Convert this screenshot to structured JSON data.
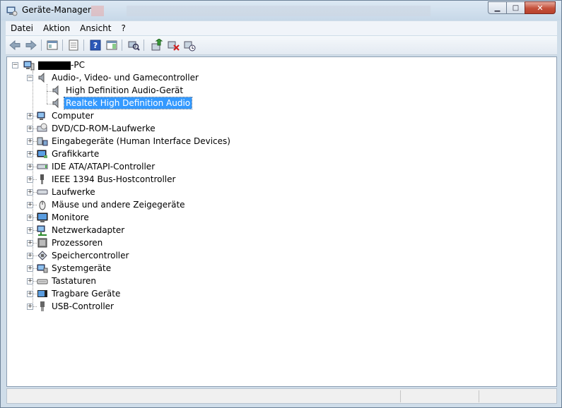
{
  "window": {
    "title": "Geräte-Manager",
    "controls": {
      "minimize": "▁",
      "maximize": "□",
      "close": "✕"
    }
  },
  "menu": [
    "Datei",
    "Aktion",
    "Ansicht",
    "?"
  ],
  "toolbar": {
    "buttons": [
      "back-arrow-icon",
      "forward-arrow-icon",
      "show-hide-console-tree-icon",
      "properties-icon",
      "help-icon",
      "action-pane-icon",
      "scan-hardware-icon",
      "update-driver-icon",
      "disable-device-icon",
      "uninstall-device-icon"
    ]
  },
  "tree": {
    "root_suffix": "-PC",
    "audio_category": "Audio-, Video- und Gamecontroller",
    "audio_children": [
      "High Definition Audio-Gerät",
      "Realtek High Definition Audio"
    ],
    "selected_item": "Realtek High Definition Audio",
    "categories": [
      "Computer",
      "DVD/CD-ROM-Laufwerke",
      "Eingabegeräte (Human Interface Devices)",
      "Grafikkarte",
      "IDE ATA/ATAPI-Controller",
      "IEEE 1394 Bus-Hostcontroller",
      "Laufwerke",
      "Mäuse und andere Zeigegeräte",
      "Monitore",
      "Netzwerkadapter",
      "Prozessoren",
      "Speichercontroller",
      "Systemgeräte",
      "Tastaturen",
      "Tragbare Geräte",
      "USB-Controller"
    ],
    "expander_collapsed": "+",
    "expander_expanded": "−"
  },
  "colors": {
    "selection": "#3399ff",
    "frame": "#cfdde9"
  }
}
